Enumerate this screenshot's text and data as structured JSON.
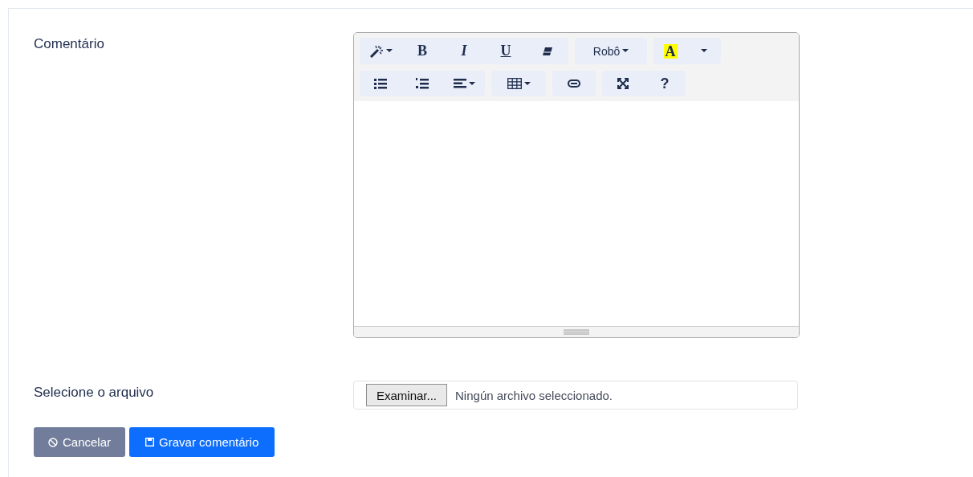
{
  "comment_label": "Comentário",
  "editor": {
    "toolbar": [
      [
        [
          {
            "kind": "magic",
            "dropdown": true
          },
          {
            "kind": "bold",
            "label": "B"
          },
          {
            "kind": "italic",
            "label": "I"
          },
          {
            "kind": "underline",
            "label": "U"
          },
          {
            "kind": "eraser"
          }
        ],
        [
          {
            "kind": "font",
            "label": "Robô",
            "dropdown": true
          }
        ],
        [
          {
            "kind": "color",
            "label": "A"
          },
          {
            "kind": "caret"
          }
        ]
      ],
      [
        [
          {
            "kind": "ul"
          },
          {
            "kind": "ol"
          },
          {
            "kind": "align",
            "dropdown": true
          }
        ],
        [
          {
            "kind": "table",
            "dropdown": true
          }
        ],
        [
          {
            "kind": "link"
          }
        ],
        [
          {
            "kind": "fullscreen"
          },
          {
            "kind": "help",
            "label": "?"
          }
        ]
      ]
    ]
  },
  "file_label": "Selecione o arquivo",
  "file_input": {
    "button": "Examinar...",
    "status": "Ningún archivo seleccionado."
  },
  "buttons": [
    {
      "kind": "cancel",
      "label": "Cancelar"
    },
    {
      "kind": "save",
      "label": "Gravar comentário"
    }
  ]
}
